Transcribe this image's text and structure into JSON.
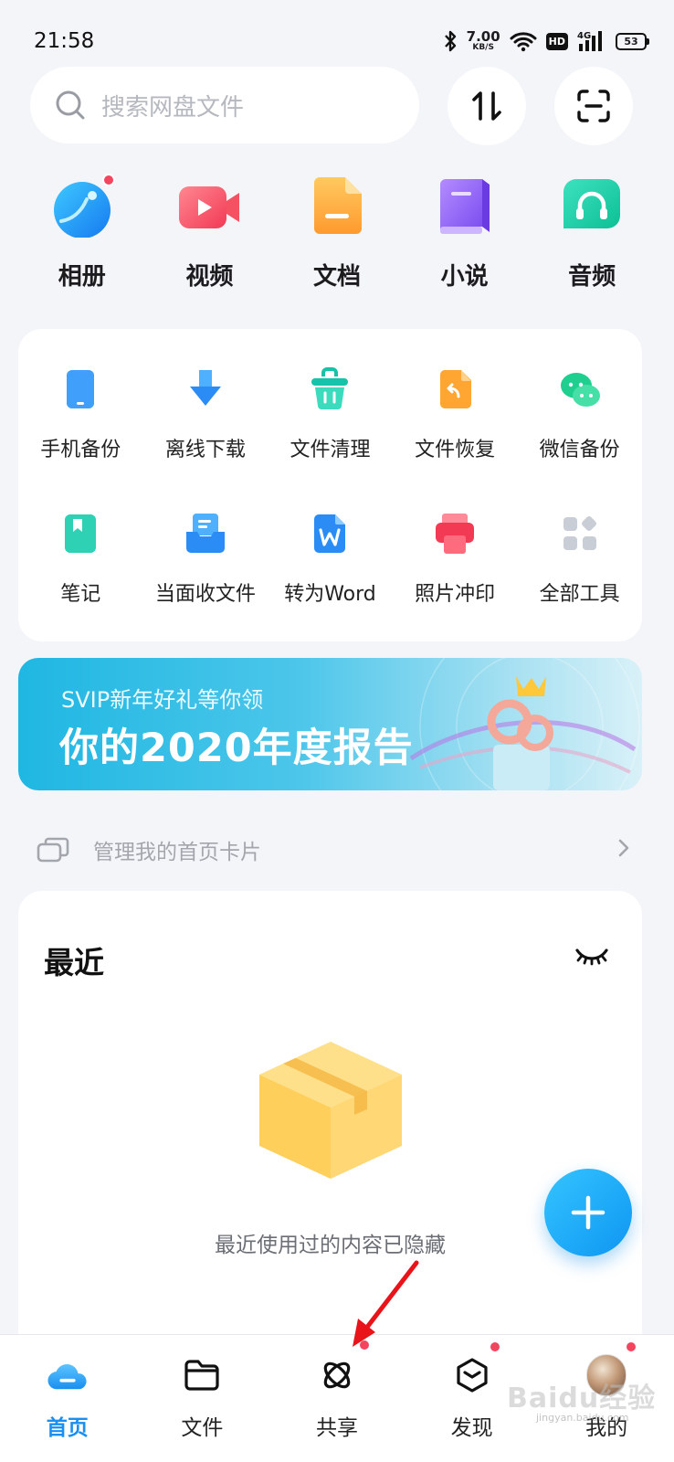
{
  "status_bar": {
    "time": "21:58",
    "net_speed_value": "7.00",
    "net_speed_unit": "KB/S",
    "hd_badge": "HD",
    "signal_label": "4G",
    "battery_level": "53",
    "icons": [
      "bluetooth-icon",
      "wifi-icon",
      "cell-signal-icon",
      "battery-icon"
    ]
  },
  "search": {
    "placeholder": "搜索网盘文件"
  },
  "top_actions": [
    "transfer-icon",
    "scan-icon"
  ],
  "categories": [
    {
      "label": "相册",
      "icon": "photo-album-icon",
      "badge": true
    },
    {
      "label": "视频",
      "icon": "video-icon",
      "badge": false
    },
    {
      "label": "文档",
      "icon": "document-icon",
      "badge": false
    },
    {
      "label": "小说",
      "icon": "novel-book-icon",
      "badge": false
    },
    {
      "label": "音频",
      "icon": "audio-headphones-icon",
      "badge": false
    }
  ],
  "tools": [
    {
      "label": "手机备份",
      "icon": "phone-backup-icon"
    },
    {
      "label": "离线下载",
      "icon": "offline-download-icon"
    },
    {
      "label": "文件清理",
      "icon": "file-cleanup-icon"
    },
    {
      "label": "文件恢复",
      "icon": "file-restore-icon"
    },
    {
      "label": "微信备份",
      "icon": "wechat-backup-icon"
    },
    {
      "label": "笔记",
      "icon": "notes-icon"
    },
    {
      "label": "当面收文件",
      "icon": "receive-file-icon"
    },
    {
      "label": "转为Word",
      "icon": "word-convert-icon"
    },
    {
      "label": "照片冲印",
      "icon": "photo-print-icon"
    },
    {
      "label": "全部工具",
      "icon": "all-tools-icon"
    }
  ],
  "banner": {
    "subtitle": "SVIP新年好礼等你领",
    "title": "你的2020年度报告"
  },
  "manage_cards": {
    "label": "管理我的首页卡片"
  },
  "recent": {
    "title": "最近",
    "empty_text": "最近使用过的内容已隐藏"
  },
  "bottom_nav": [
    {
      "label": "首页",
      "icon": "home-cloud-icon",
      "active": true,
      "badge": false
    },
    {
      "label": "文件",
      "icon": "folder-icon",
      "active": false,
      "badge": false
    },
    {
      "label": "共享",
      "icon": "share-orbit-icon",
      "active": false,
      "badge": true
    },
    {
      "label": "发现",
      "icon": "discover-box-icon",
      "active": false,
      "badge": true
    },
    {
      "label": "我的",
      "icon": "profile-avatar-icon",
      "active": false,
      "badge": true
    }
  ],
  "watermark": {
    "text": "Baidu经验",
    "sub": "jingyan.baidu.com"
  },
  "colors": {
    "accent": "#1a8ff0",
    "badge": "#f4455f",
    "annotation_arrow": "#e8141a"
  }
}
